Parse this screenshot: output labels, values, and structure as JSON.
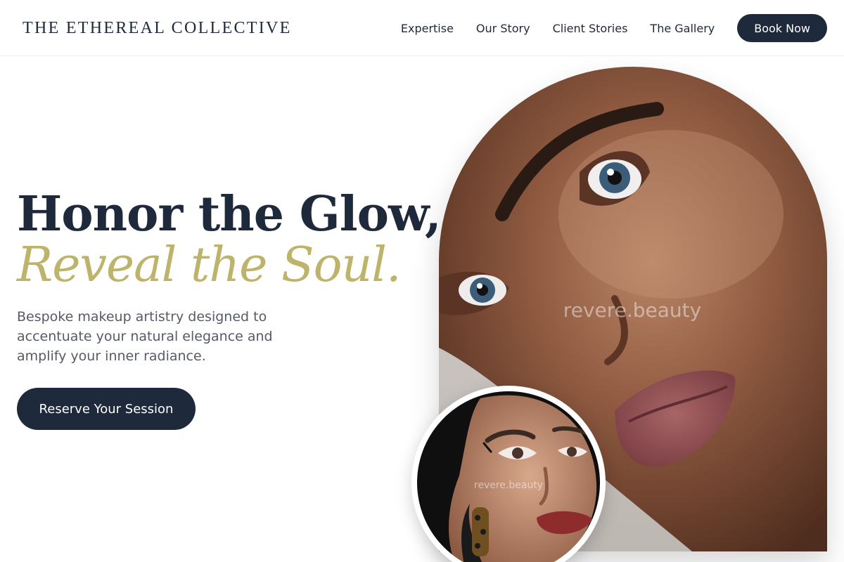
{
  "header": {
    "brand": "THE ETHEREAL COLLECTIVE",
    "nav": [
      {
        "label": "Expertise"
      },
      {
        "label": "Our Story"
      },
      {
        "label": "Client Stories"
      },
      {
        "label": "The Gallery"
      }
    ],
    "cta": "Book Now"
  },
  "hero": {
    "title": "Honor the Glow,",
    "title_accent": "Reveal the Soul.",
    "description": "Bespoke makeup artistry designed to accentuate your natural elegance and amplify your inner radiance.",
    "cta": "Reserve Your Session"
  },
  "images": {
    "main_watermark": "revere.beauty",
    "inset_watermark": "revere.beauty"
  },
  "colors": {
    "navy": "#1e293b",
    "gold": "#bdb36a",
    "text_muted": "#555b66"
  }
}
